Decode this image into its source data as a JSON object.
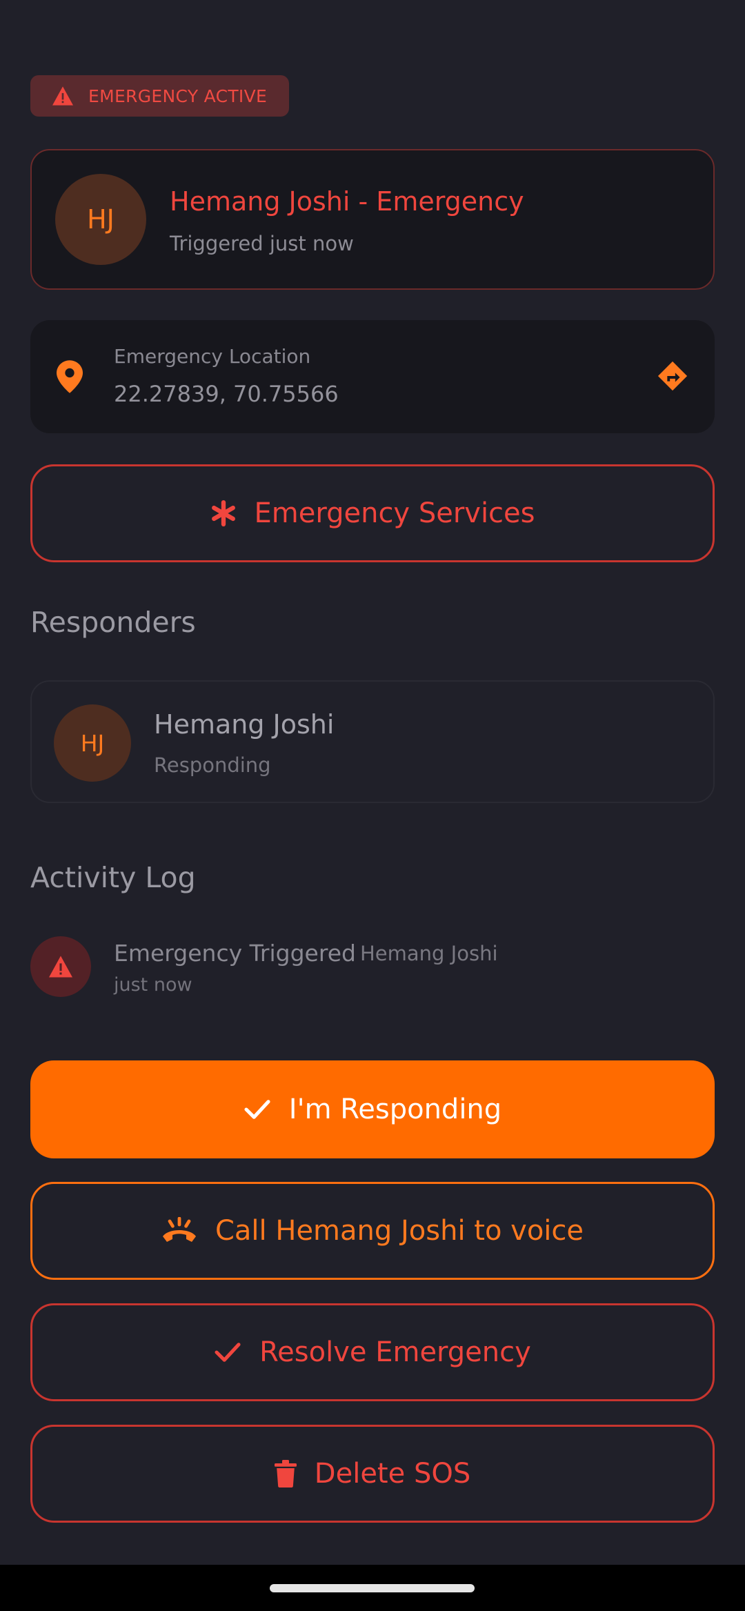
{
  "badge": {
    "label": "EMERGENCY ACTIVE",
    "icon": "warning-icon"
  },
  "header": {
    "initials": "HJ",
    "title": "Hemang Joshi - Emergency",
    "subtitle": "Triggered just now"
  },
  "location": {
    "label": "Emergency Location",
    "value": "22.27839, 70.75566",
    "pin_icon": "location-pin-icon",
    "directions_icon": "directions-icon"
  },
  "emergency_services": {
    "label": "Emergency Services",
    "icon": "asterisk-icon"
  },
  "responders": {
    "title": "Responders",
    "items": [
      {
        "initials": "HJ",
        "name": "Hemang Joshi",
        "status": "Responding"
      }
    ]
  },
  "activity": {
    "title": "Activity Log",
    "items": [
      {
        "event": "Emergency Triggered",
        "user": "Hemang Joshi",
        "time": "just now",
        "icon": "warning-icon"
      }
    ]
  },
  "actions": {
    "responding": "I'm Responding",
    "call": "Call Hemang Joshi to voice",
    "resolve": "Resolve Emergency",
    "delete": "Delete SOS"
  },
  "colors": {
    "background": "#202029",
    "card": "#17171d",
    "danger": "#f0463e",
    "accent": "#ff6b00"
  }
}
